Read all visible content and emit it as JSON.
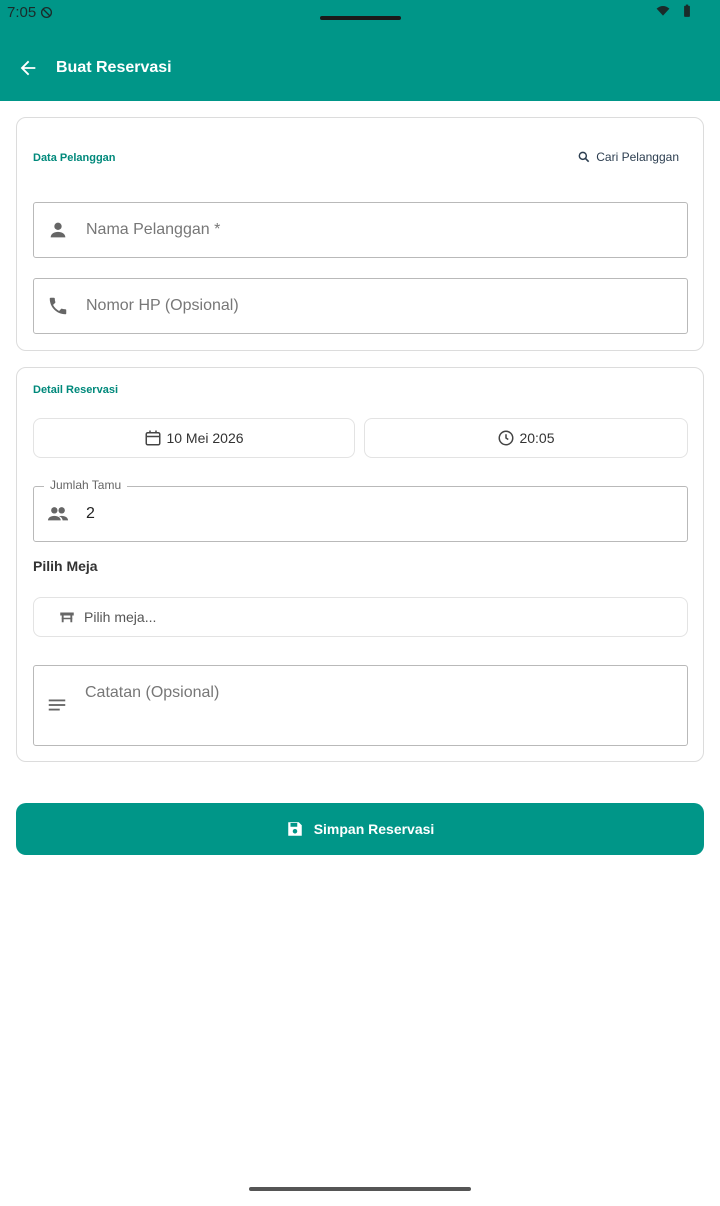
{
  "status_bar": {
    "time": "7:05"
  },
  "app_bar": {
    "title": "Buat Reservasi"
  },
  "customer_section": {
    "title": "Data Pelanggan",
    "search_label": "Cari Pelanggan",
    "name_placeholder": "Nama Pelanggan *",
    "phone_placeholder": "Nomor HP (Opsional)"
  },
  "reservation_section": {
    "title": "Detail Reservasi",
    "date": "10 Mei 2026",
    "time": "20:05",
    "guests_label": "Jumlah Tamu",
    "guests_value": "2",
    "table_heading": "Pilih Meja",
    "table_placeholder": "Pilih meja...",
    "notes_placeholder": "Catatan (Opsional)"
  },
  "save_button": {
    "label": "Simpan Reservasi"
  },
  "colors": {
    "primary": "#009688",
    "section_title": "#00897b"
  },
  "icons": {
    "back": "arrow-back-icon",
    "search": "search-icon",
    "person": "person-icon",
    "phone": "phone-icon",
    "calendar": "calendar-icon",
    "clock": "clock-icon",
    "people": "people-icon",
    "table": "table-icon",
    "notes": "notes-icon",
    "save": "save-icon"
  }
}
